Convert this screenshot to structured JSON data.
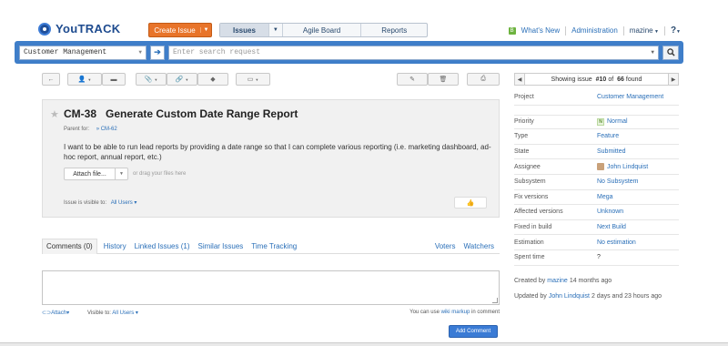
{
  "header": {
    "logo_text": "YouTRACK",
    "create_issue": "Create Issue",
    "tabs": [
      "Issues",
      "Agile Board",
      "Reports"
    ],
    "whats_new": "What's New",
    "whats_new_badge": "B",
    "administration": "Administration",
    "user": "mazine",
    "help": "?"
  },
  "search": {
    "context": "Customer Management",
    "placeholder": "Enter search request"
  },
  "pager": {
    "prefix": "Showing issue",
    "current": "#10",
    "of": "of",
    "total": "66",
    "suffix": "found"
  },
  "issue": {
    "id": "CM-38",
    "title": "Generate Custom Date Range Report",
    "parent_label": "Parent for:",
    "parent_link": "CM-62",
    "description": "I want to be able to run lead reports by providing a date range so that I can complete various reporting (i.e. marketing dashboard, ad-hoc report, annual report, etc.)",
    "attach_file": "Attach file...",
    "drag_hint": "or drag your files here",
    "visible_label": "Issue is visible to:",
    "visible_value": "All Users"
  },
  "tabs": {
    "comments": "Comments (0)",
    "history": "History",
    "linked": "Linked Issues (1)",
    "similar": "Similar Issues",
    "time": "Time Tracking",
    "voters": "Voters",
    "watchers": "Watchers"
  },
  "comment": {
    "attach": "Attach",
    "visible_label": "Visible to:",
    "visible_value": "All Users",
    "markup_prefix": "You can use",
    "markup_link": "wiki markup",
    "markup_suffix": "in comment",
    "add_button": "Add Comment"
  },
  "fields": [
    {
      "key": "Project",
      "value": "Customer Management"
    },
    {
      "key": "Priority",
      "value": "Normal",
      "badge": "N"
    },
    {
      "key": "Type",
      "value": "Feature"
    },
    {
      "key": "State",
      "value": "Submitted"
    },
    {
      "key": "Assignee",
      "value": "John Lindquist"
    },
    {
      "key": "Subsystem",
      "value": "No Subsystem"
    },
    {
      "key": "Fix versions",
      "value": "Mega"
    },
    {
      "key": "Affected versions",
      "value": "Unknown"
    },
    {
      "key": "Fixed in build",
      "value": "Next Build"
    },
    {
      "key": "Estimation",
      "value": "No estimation"
    },
    {
      "key": "Spent time",
      "value": "?"
    }
  ],
  "meta": {
    "created_prefix": "Created by",
    "created_user": "mazine",
    "created_when": "14 months ago",
    "updated_prefix": "Updated by",
    "updated_user": "John Lindquist",
    "updated_when": "2 days and 23 hours ago"
  },
  "colors": {
    "accent": "#3f7ec9",
    "create": "#e8742a",
    "link": "#2a6fb8"
  }
}
